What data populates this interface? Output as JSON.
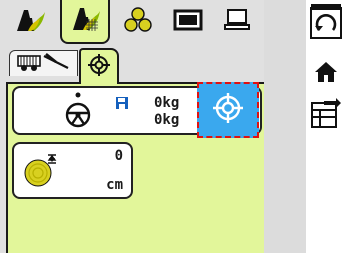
{
  "top_tabs": [
    {
      "icon": "harvester-tab-icon",
      "active": false
    },
    {
      "icon": "harvester-grid-tab-icon",
      "active": true
    },
    {
      "icon": "bales-tab-icon",
      "active": false
    },
    {
      "icon": "screen-tab-icon",
      "active": false
    },
    {
      "icon": "computer-tab-icon",
      "active": false
    }
  ],
  "side_buttons": [
    {
      "icon": "refresh-icon"
    },
    {
      "icon": "home-icon"
    },
    {
      "icon": "transfer-list-icon"
    }
  ],
  "sub_tabs": [
    {
      "icon": "trailer-tools-icon",
      "active": false
    },
    {
      "icon": "target-icon",
      "active": true
    }
  ],
  "weight_card": {
    "steering_icon": "steering-wheel-icon",
    "save_icon": "floppy-disk-icon",
    "value1": "0kg",
    "value2": "0kg",
    "target_button_icon": "crosshair-target-icon"
  },
  "height_card": {
    "bale_icon": "bale-height-icon",
    "value": "0",
    "unit": "cm"
  },
  "colors": {
    "active_green": "#e2f69a",
    "target_blue": "#3aa8ee",
    "highlight_red": "#e01010",
    "frame_gray": "#e0e0e0"
  }
}
